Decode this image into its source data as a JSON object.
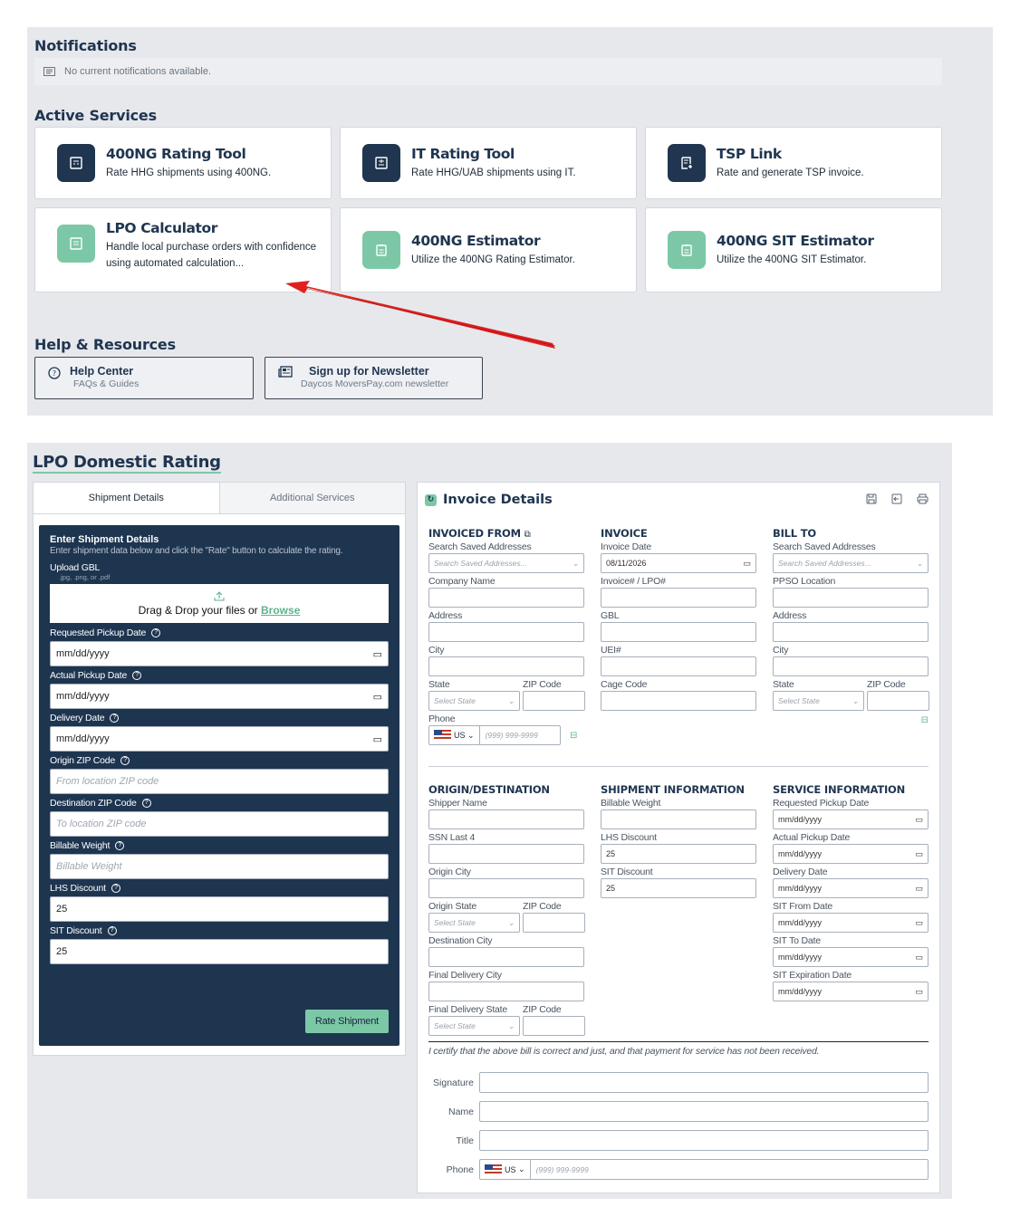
{
  "notifications": {
    "title": "Notifications",
    "empty_text": "No current notifications available."
  },
  "active_services": {
    "title": "Active Services",
    "cards": [
      {
        "title": "400NG Rating Tool",
        "desc": "Rate HHG shipments using 400NG."
      },
      {
        "title": "IT Rating Tool",
        "desc": "Rate HHG/UAB shipments using IT."
      },
      {
        "title": "TSP Link",
        "desc": "Rate and generate TSP invoice."
      },
      {
        "title": "LPO Calculator",
        "desc": "Handle local purchase orders with confidence using automated calculation..."
      },
      {
        "title": "400NG Estimator",
        "desc": "Utilize the 400NG Rating Estimator."
      },
      {
        "title": "400NG SIT Estimator",
        "desc": "Utilize the 400NG SIT Estimator."
      }
    ]
  },
  "help": {
    "title": "Help & Resources",
    "items": [
      {
        "title": "Help Center",
        "sub": "FAQs & Guides"
      },
      {
        "title": "Sign up for Newsletter",
        "sub": "Daycos MoversPay.com newsletter"
      }
    ]
  },
  "lpo": {
    "title": "LPO Domestic Rating"
  },
  "tabs": [
    "Shipment Details",
    "Additional Services"
  ],
  "shipment_form": {
    "heading": "Enter Shipment Details",
    "subheading": "Enter shipment data below and click the \"Rate\" button to calculate the rating.",
    "upload_label": "Upload GBL",
    "upload_hint": ".jpg, .png, or .pdf",
    "drop_text": "Drag & Drop your files or",
    "browse": "Browse",
    "requested_pickup_label": "Requested Pickup Date",
    "actual_pickup_label": "Actual Pickup Date",
    "delivery_label": "Delivery Date",
    "date_ph": "mm/dd/yyyy",
    "origin_zip_label": "Origin ZIP Code",
    "origin_zip_ph": "From location ZIP code",
    "dest_zip_label": "Destination ZIP Code",
    "dest_zip_ph": "To location ZIP code",
    "weight_label": "Billable Weight",
    "weight_ph": "Billable Weight",
    "lhs_label": "LHS Discount",
    "lhs_value": "25",
    "sit_label": "SIT Discount",
    "sit_value": "25",
    "rate_button": "Rate Shipment"
  },
  "invoice": {
    "title": "Invoice Details",
    "invoiced_from": {
      "title": "INVOICED FROM",
      "search_label": "Search Saved Addresses",
      "search_ph": "Search Saved Addresses...",
      "company": "Company Name",
      "address": "Address",
      "city": "City",
      "state": "State",
      "zip": "ZIP Code",
      "state_ph": "Select State",
      "phone": "Phone",
      "country": "US",
      "phone_ph": "(999) 999-9999"
    },
    "invoice_col": {
      "title": "INVOICE",
      "date_label": "Invoice Date",
      "date_value": "08/11/2026",
      "invoice_no": "Invoice# / LPO#",
      "gbl": "GBL",
      "uei": "UEI#",
      "cage": "Cage Code"
    },
    "bill_to": {
      "title": "BILL TO",
      "search_label": "Search Saved Addresses",
      "search_ph": "Search Saved Addresses...",
      "ppso": "PPSO Location",
      "address": "Address",
      "city": "City",
      "state": "State",
      "zip": "ZIP Code",
      "state_ph": "Select State"
    },
    "origin_dest": {
      "title": "ORIGIN/DESTINATION",
      "shipper": "Shipper Name",
      "ssn": "SSN Last 4",
      "origin_city": "Origin City",
      "origin_state": "Origin State",
      "zip": "ZIP Code",
      "state_ph": "Select State",
      "dest_city": "Destination City",
      "final_city": "Final Delivery City",
      "final_state": "Final Delivery State"
    },
    "shipment_info": {
      "title": "SHIPMENT INFORMATION",
      "weight": "Billable Weight",
      "lhs": "LHS Discount",
      "lhs_value": "25",
      "sit": "SIT Discount",
      "sit_value": "25"
    },
    "service_info": {
      "title": "SERVICE INFORMATION",
      "req_pickup": "Requested Pickup Date",
      "act_pickup": "Actual Pickup Date",
      "delivery": "Delivery Date",
      "sit_from": "SIT From Date",
      "sit_to": "SIT To Date",
      "sit_exp": "SIT Expiration Date",
      "date_ph": "mm/dd/yyyy"
    },
    "certify": "I certify that the above bill is correct and just, and that payment for service has not been received.",
    "signature": "Signature",
    "name": "Name",
    "title_label": "Title",
    "phone": "Phone",
    "country": "US",
    "phone_ph": "(999) 999-9999"
  }
}
